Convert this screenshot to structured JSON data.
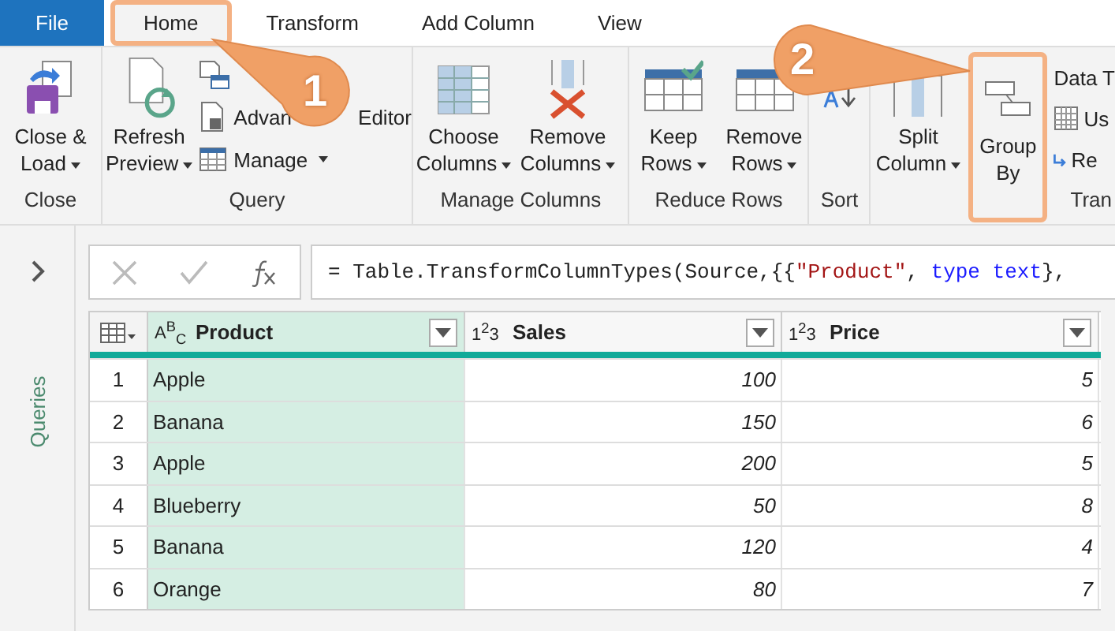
{
  "tabs": [
    {
      "label": "File",
      "kind": "file",
      "selected": false,
      "highlighted": false
    },
    {
      "label": "Home",
      "kind": "tab",
      "selected": true,
      "highlighted": true
    },
    {
      "label": "Transform",
      "kind": "tab",
      "selected": false,
      "highlighted": false
    },
    {
      "label": "Add Column",
      "kind": "tab",
      "selected": false,
      "highlighted": false
    },
    {
      "label": "View",
      "kind": "tab",
      "selected": false,
      "highlighted": false
    }
  ],
  "ribbon": {
    "close": {
      "label": "Close",
      "button": {
        "lines": [
          "Close &",
          "Load"
        ],
        "dropdown": true
      }
    },
    "query": {
      "label": "Query",
      "refresh": {
        "lines": [
          "Refresh",
          "Preview"
        ],
        "dropdown": true
      },
      "advanced_editor": [
        "Advan",
        "Editor"
      ],
      "manage": {
        "label": "Manage",
        "dropdown": true
      }
    },
    "manage_columns": {
      "label": "Manage Columns",
      "buttons": [
        {
          "lines": [
            "Choose",
            "Columns"
          ],
          "dropdown": true
        },
        {
          "lines": [
            "Remove",
            "Columns"
          ],
          "dropdown": true
        }
      ]
    },
    "reduce_rows": {
      "label": "Reduce Rows",
      "buttons": [
        {
          "lines": [
            "Keep",
            "Rows"
          ],
          "dropdown": true
        },
        {
          "lines": [
            "Remove",
            "Rows"
          ],
          "dropdown": true
        }
      ]
    },
    "sort": {
      "label": "Sort"
    },
    "transform": {
      "label": "Tran",
      "split": {
        "lines": [
          "Split",
          "Column"
        ],
        "dropdown": true
      },
      "group_by": {
        "lines": [
          "Group",
          "By"
        ],
        "highlighted": true
      },
      "small": [
        "Data T",
        "Us",
        "Re"
      ]
    }
  },
  "callouts": [
    {
      "number": "1"
    },
    {
      "number": "2"
    }
  ],
  "sidebar": {
    "label": "Queries"
  },
  "formula": [
    {
      "text": "= Table.TransformColumnTypes(Source,{{",
      "kind": "plain"
    },
    {
      "text": "\"Product\"",
      "kind": "string"
    },
    {
      "text": ", ",
      "kind": "plain"
    },
    {
      "text": "type text",
      "kind": "keyword"
    },
    {
      "text": "},",
      "kind": "plain"
    }
  ],
  "table": {
    "columns": [
      {
        "type": "A$^{B}$$_{C}$",
        "name": "Product",
        "selected": true,
        "kind": "text"
      },
      {
        "type": "1$^{2}$3",
        "name": "Sales",
        "selected": false,
        "kind": "number"
      },
      {
        "type": "1$^{2}$3",
        "name": "Price",
        "selected": false,
        "kind": "number"
      }
    ],
    "rows": [
      {
        "number": "1",
        "cells": [
          "Apple",
          "100",
          "5"
        ]
      },
      {
        "number": "2",
        "cells": [
          "Banana",
          "150",
          "6"
        ]
      },
      {
        "number": "3",
        "cells": [
          "Apple",
          "200",
          "5"
        ]
      },
      {
        "number": "4",
        "cells": [
          "Blueberry",
          "50",
          "8"
        ]
      },
      {
        "number": "5",
        "cells": [
          "Banana",
          "120",
          "4"
        ]
      },
      {
        "number": "6",
        "cells": [
          "Orange",
          "80",
          "7"
        ]
      }
    ]
  }
}
